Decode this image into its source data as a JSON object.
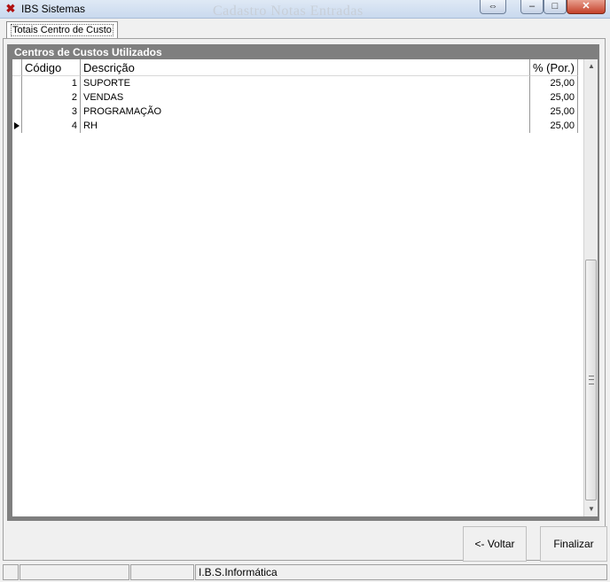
{
  "window": {
    "title": "IBS Sistemas",
    "background_title": "Cadastro Notas Entradas",
    "buttons": {
      "restore": "⇔",
      "minimize": "–",
      "maximize": "□",
      "close": "✕"
    }
  },
  "tabs": [
    {
      "label": "Totais Centro de Custo",
      "active": true
    }
  ],
  "panel": {
    "title": "Centros de Custos Utilizados"
  },
  "grid": {
    "columns": [
      "Código",
      "Descrição",
      "% (Por.)"
    ],
    "rows": [
      {
        "codigo": "1",
        "descricao": "SUPORTE",
        "perc": "25,00"
      },
      {
        "codigo": "2",
        "descricao": "VENDAS",
        "perc": "25,00"
      },
      {
        "codigo": "3",
        "descricao": "PROGRAMAÇÃO",
        "perc": "25,00"
      },
      {
        "codigo": "4",
        "descricao": "RH",
        "perc": "25,00"
      }
    ],
    "current_row": 3
  },
  "actions": {
    "back_label": "<- Voltar",
    "finish_label": "Finalizar"
  },
  "statusbar": {
    "company": "I.B.S.Informática"
  },
  "colors": {
    "panel": "#7f7f7f",
    "titlebar": "#c9d9ee",
    "close": "#c4412a"
  }
}
